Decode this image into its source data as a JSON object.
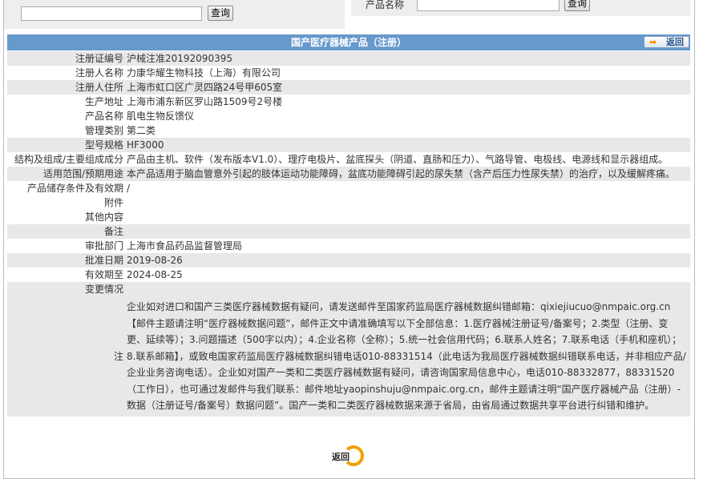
{
  "search": {
    "left_button": "查询",
    "right_label": "产品名称",
    "right_button": "查询",
    "left_value": "",
    "right_value": ""
  },
  "header": {
    "title": "国产医疗器械产品（注册）",
    "back": "返回"
  },
  "rows": [
    {
      "label": "注册证编号",
      "value": "沪械注准20192090395"
    },
    {
      "label": "注册人名称",
      "value": "力康华耀生物科技（上海）有限公司"
    },
    {
      "label": "注册人住所",
      "value": "上海市虹口区广灵四路24号甲605室"
    },
    {
      "label": "生产地址",
      "value": "上海市浦东新区罗山路1509号2号楼"
    },
    {
      "label": "产品名称",
      "value": "肌电生物反馈仪"
    },
    {
      "label": "管理类别",
      "value": "第二类"
    },
    {
      "label": "型号规格",
      "value": "HF3000"
    },
    {
      "label": "结构及组成/主要组成成分",
      "value": "产品由主机、软件（发布版本V1.0）、理疗电极片、盆底探头（阴道、直肠和压力）、气路导管、电极线、电源线和显示器组成。"
    },
    {
      "label": "适用范围/预期用途",
      "value": "本产品适用于脑血管意外引起的肢体运动功能障碍，盆底功能障碍引起的尿失禁（含产后压力性尿失禁）的治疗，以及缓解疼痛。"
    },
    {
      "label": "产品储存条件及有效期",
      "value": "/"
    },
    {
      "label": "附件",
      "value": ""
    },
    {
      "label": "其他内容",
      "value": ""
    },
    {
      "label": "备注",
      "value": ""
    },
    {
      "label": "审批部门",
      "value": "上海市食品药品监督管理局"
    },
    {
      "label": "批准日期",
      "value": "2019-08-26"
    },
    {
      "label": "有效期至",
      "value": "2024-08-25"
    },
    {
      "label": "变更情况",
      "value": ""
    }
  ],
  "note": {
    "label": "注",
    "text": "企业如对进口和国产三类医疗器械数据有疑问，请发送邮件至国家药监局医疗器械数据纠错邮箱：qixiejiucuo@nmpaic.org.cn【邮件主题请注明“医疗器械数据问题”，邮件正文中请准确填写以下全部信息：1.医疗器械注册证号/备案号；2.类型（注册、变更、延续等）；3.问题描述（500字以内）；4.企业名称（全称）；5.统一社会信用代码；6.联系人姓名；7.联系电话（手机和座机）；8.联系邮箱】，或致电国家药监局医疗器械数据纠错电话010-88331514（此电话为我局医疗器械数据纠错联系电话，并非相应产品/企业业务咨询电话）。企业如对国产一类和二类医疗器械数据有疑问，请咨询国家局信息中心，电话010-88332877，88331520（工作日），也可通过发邮件与我们联系：邮件地址yaopinshuju@nmpaic.org.cn，邮件主题请注明“国产医疗器械产品（注册）-数据（注册证号/备案号）数据问题”。国产一类和二类医疗器械数据来源于省局，由省局通过数据共享平台进行纠错和维护。"
  },
  "bottom": {
    "back": "返回"
  }
}
